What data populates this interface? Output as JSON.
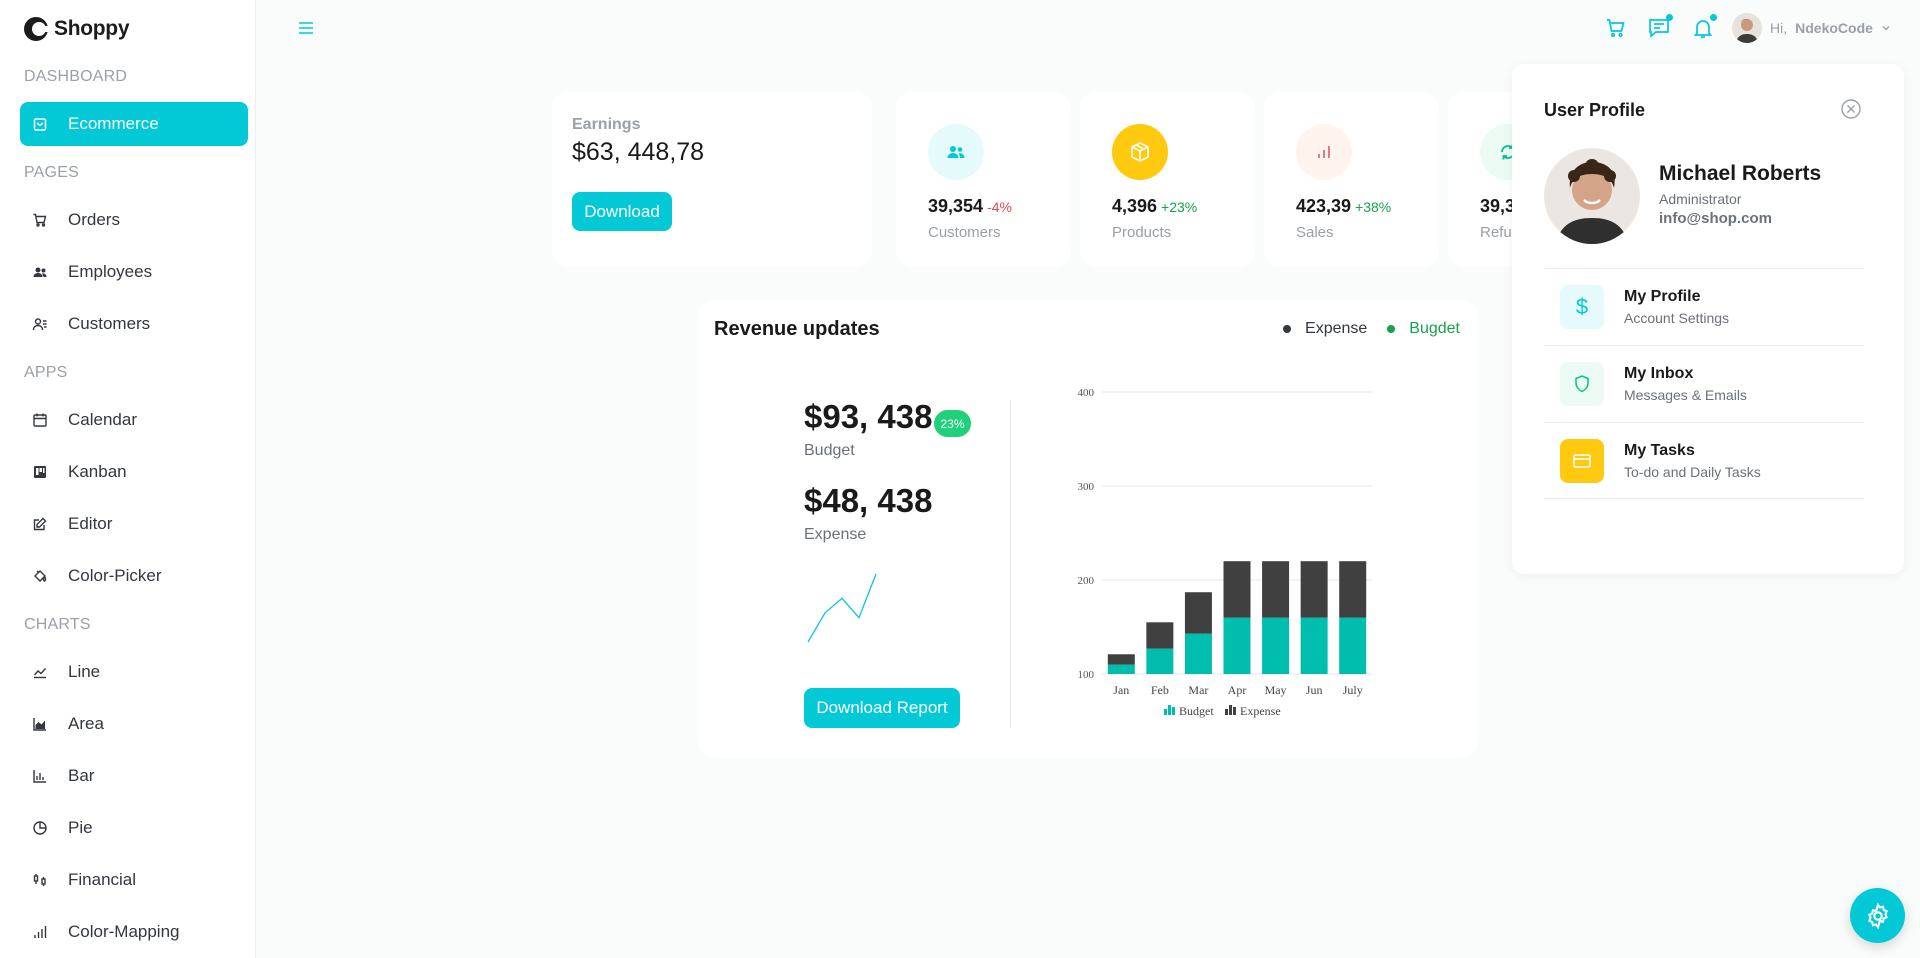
{
  "brand": {
    "name": "Shoppy",
    "accent": "#03c9d7"
  },
  "sidebar": {
    "sections": [
      {
        "label": "DASHBOARD",
        "items": [
          {
            "label": "Ecommerce",
            "icon": "bag-icon",
            "active": true
          }
        ]
      },
      {
        "label": "PAGES",
        "items": [
          {
            "label": "Orders",
            "icon": "cart-icon"
          },
          {
            "label": "Employees",
            "icon": "employees-icon"
          },
          {
            "label": "Customers",
            "icon": "customers-icon"
          }
        ]
      },
      {
        "label": "APPS",
        "items": [
          {
            "label": "Calendar",
            "icon": "calendar-icon"
          },
          {
            "label": "Kanban",
            "icon": "kanban-icon"
          },
          {
            "label": "Editor",
            "icon": "edit-icon"
          },
          {
            "label": "Color-Picker",
            "icon": "paint-bucket-icon"
          }
        ]
      },
      {
        "label": "CHARTS",
        "items": [
          {
            "label": "Line",
            "icon": "line-chart-icon"
          },
          {
            "label": "Area",
            "icon": "area-chart-icon"
          },
          {
            "label": "Bar",
            "icon": "bar-chart-icon"
          },
          {
            "label": "Pie",
            "icon": "pie-chart-icon"
          },
          {
            "label": "Financial",
            "icon": "financial-icon"
          },
          {
            "label": "Color-Mapping",
            "icon": "color-mapping-icon"
          }
        ]
      }
    ]
  },
  "topbar": {
    "greeting": "Hi,",
    "username": "NdekoCode"
  },
  "earnings": {
    "label": "Earnings",
    "value": "$63, 448,78",
    "button": "Download"
  },
  "stats": [
    {
      "value": "39,354",
      "change": "-4%",
      "change_color": "#e5484d",
      "label": "Customers",
      "icon": "customers-icon",
      "bg": "#e5fafb",
      "fg": "#03c9d7"
    },
    {
      "value": "4,396",
      "change": "+23%",
      "change_color": "#16a34a",
      "label": "Products",
      "icon": "box-icon",
      "bg": "#fec90f",
      "fg": "#ffffff"
    },
    {
      "value": "423,39",
      "change": "+38%",
      "change_color": "#16a34a",
      "label": "Sales",
      "icon": "sales-chart-icon",
      "bg": "#fff4ed",
      "fg": "#e46a76"
    },
    {
      "value": "39,3",
      "change": "",
      "change_color": "#16a34a",
      "label": "Refu",
      "icon": "refund-icon",
      "bg": "#ebfaf2",
      "fg": "#00c292"
    }
  ],
  "revenue": {
    "title": "Revenue updates",
    "legend": [
      {
        "label": "Expense",
        "color": "#33373e"
      },
      {
        "label": "Bugdet",
        "color": "#16a34a"
      }
    ],
    "budget_value": "$93, 438",
    "budget_pct": "23%",
    "budget_label": "Budget",
    "expense_value": "$48, 438",
    "expense_label": "Expense",
    "button": "Download Report"
  },
  "sparkline": {
    "values": [
      2,
      14,
      20,
      12,
      30
    ]
  },
  "chart_data": {
    "type": "bar",
    "stacked": true,
    "categories": [
      "Jan",
      "Feb",
      "Mar",
      "Apr",
      "May",
      "Jun",
      "July"
    ],
    "series": [
      {
        "name": "Budget",
        "values": [
          110,
          127,
          143,
          160,
          160,
          160,
          160
        ],
        "color": "#00bdae"
      },
      {
        "name": "Expense",
        "values": [
          111,
          128,
          144,
          160,
          160,
          160,
          160
        ],
        "color": "#404041"
      }
    ],
    "ylim": [
      100,
      400
    ],
    "yticks": [
      100,
      200,
      300,
      400
    ],
    "grid": true,
    "legend_position": "bottom"
  },
  "profile": {
    "title": "User Profile",
    "name": "Michael Roberts",
    "role": "Administrator",
    "email": "info@shop.com",
    "items": [
      {
        "title": "My Profile",
        "sub": "Account Settings",
        "icon": "dollar-icon",
        "bg": "#e5fafb",
        "fg": "#03c9d7"
      },
      {
        "title": "My Inbox",
        "sub": "Messages & Emails",
        "icon": "shield-icon",
        "bg": "#ebfaf2",
        "fg": "#00c292"
      },
      {
        "title": "My Tasks",
        "sub": "To-do and Daily Tasks",
        "icon": "card-icon",
        "bg": "#fec90f",
        "fg": "#ffffff"
      }
    ]
  }
}
